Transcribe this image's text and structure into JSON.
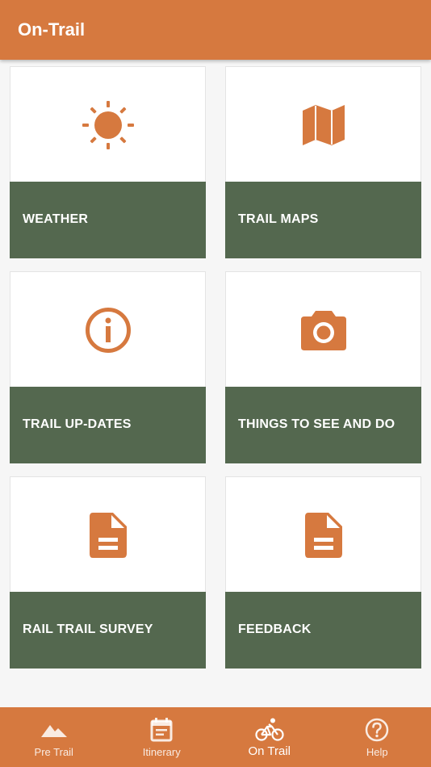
{
  "app_bar": {
    "title": "On-Trail"
  },
  "tiles": [
    {
      "label": "WEATHER",
      "icon": "sun-icon"
    },
    {
      "label": "TRAIL MAPS",
      "icon": "map-icon"
    },
    {
      "label": "TRAIL UP-DATES",
      "icon": "info-icon"
    },
    {
      "label": "THINGS TO SEE AND DO",
      "icon": "camera-icon"
    },
    {
      "label": "RAIL TRAIL SURVEY",
      "icon": "document-icon"
    },
    {
      "label": "FEEDBACK",
      "icon": "document-icon"
    }
  ],
  "bottom_nav": {
    "items": [
      {
        "label": "Pre Trail",
        "icon": "mountain-icon",
        "active": false
      },
      {
        "label": "Itinerary",
        "icon": "calendar-icon",
        "active": false
      },
      {
        "label": "On Trail",
        "icon": "bicycle-icon",
        "active": true
      },
      {
        "label": "Help",
        "icon": "help-circle-icon",
        "active": false
      }
    ]
  },
  "colors": {
    "primary": "#d6793f",
    "tile_label_bg": "#54684f",
    "icon": "#d6793f",
    "background": "#f6f6f6"
  }
}
